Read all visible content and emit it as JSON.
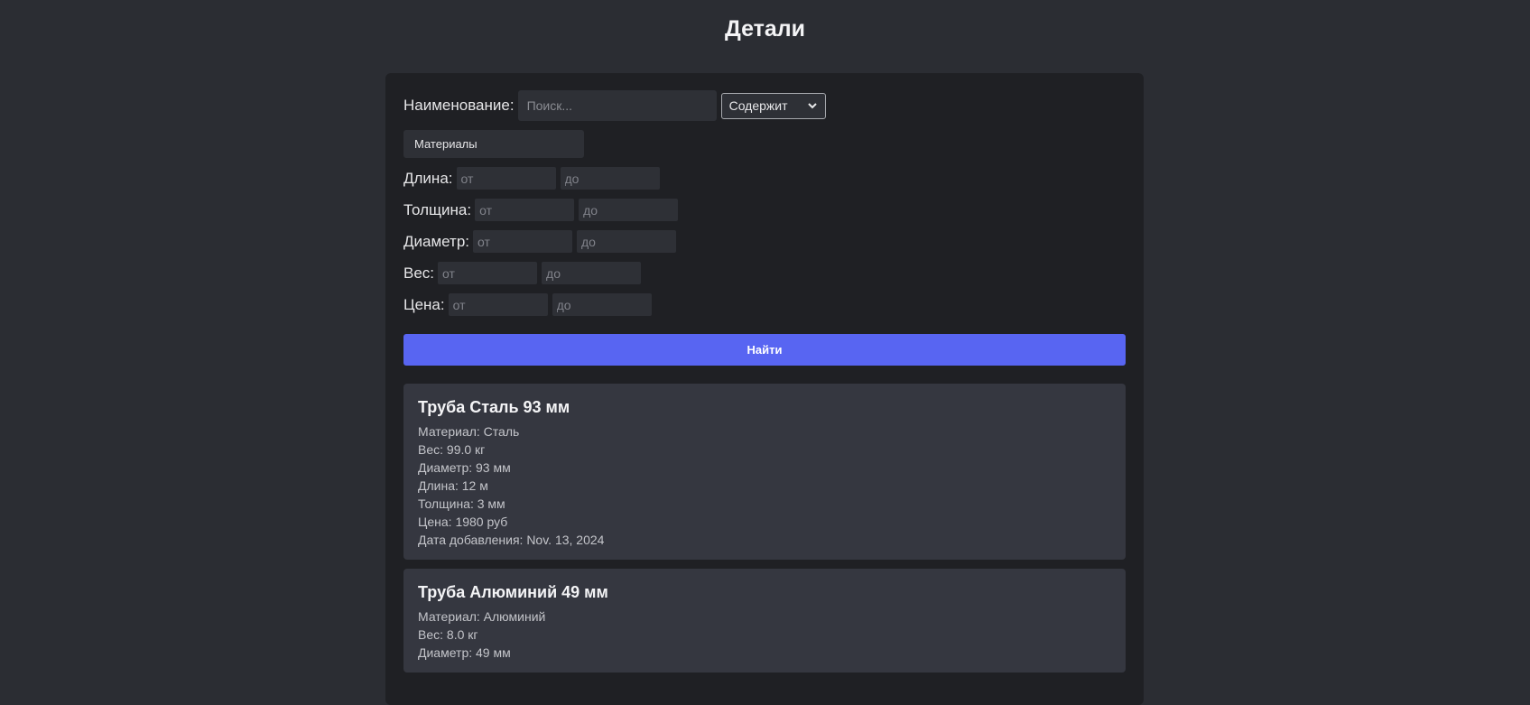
{
  "page": {
    "title": "Детали"
  },
  "filters": {
    "name_label": "Наименование:",
    "search_placeholder": "Поиск...",
    "mode_selected": "Содержит",
    "materials_label": "Материалы",
    "ranges": [
      {
        "label": "Длина:",
        "from_placeholder": "от",
        "to_placeholder": "до"
      },
      {
        "label": "Толщина:",
        "from_placeholder": "от",
        "to_placeholder": "до"
      },
      {
        "label": "Диаметр:",
        "from_placeholder": "от",
        "to_placeholder": "до"
      },
      {
        "label": "Вес:",
        "from_placeholder": "от",
        "to_placeholder": "до"
      },
      {
        "label": "Цена:",
        "from_placeholder": "от",
        "to_placeholder": "до"
      }
    ],
    "search_button": "Найти"
  },
  "results": [
    {
      "title": "Труба Сталь 93 мм",
      "lines": [
        "Материал: Сталь",
        "Вес: 99.0 кг",
        "Диаметр: 93 мм",
        "Длина: 12 м",
        "Толщина: 3 мм",
        "Цена: 1980 руб",
        "Дата добавления: Nov. 13, 2024"
      ]
    },
    {
      "title": "Труба Алюминий 49 мм",
      "lines": [
        "Материал: Алюминий",
        "Вес: 8.0 кг",
        "Диаметр: 49 мм"
      ]
    }
  ]
}
